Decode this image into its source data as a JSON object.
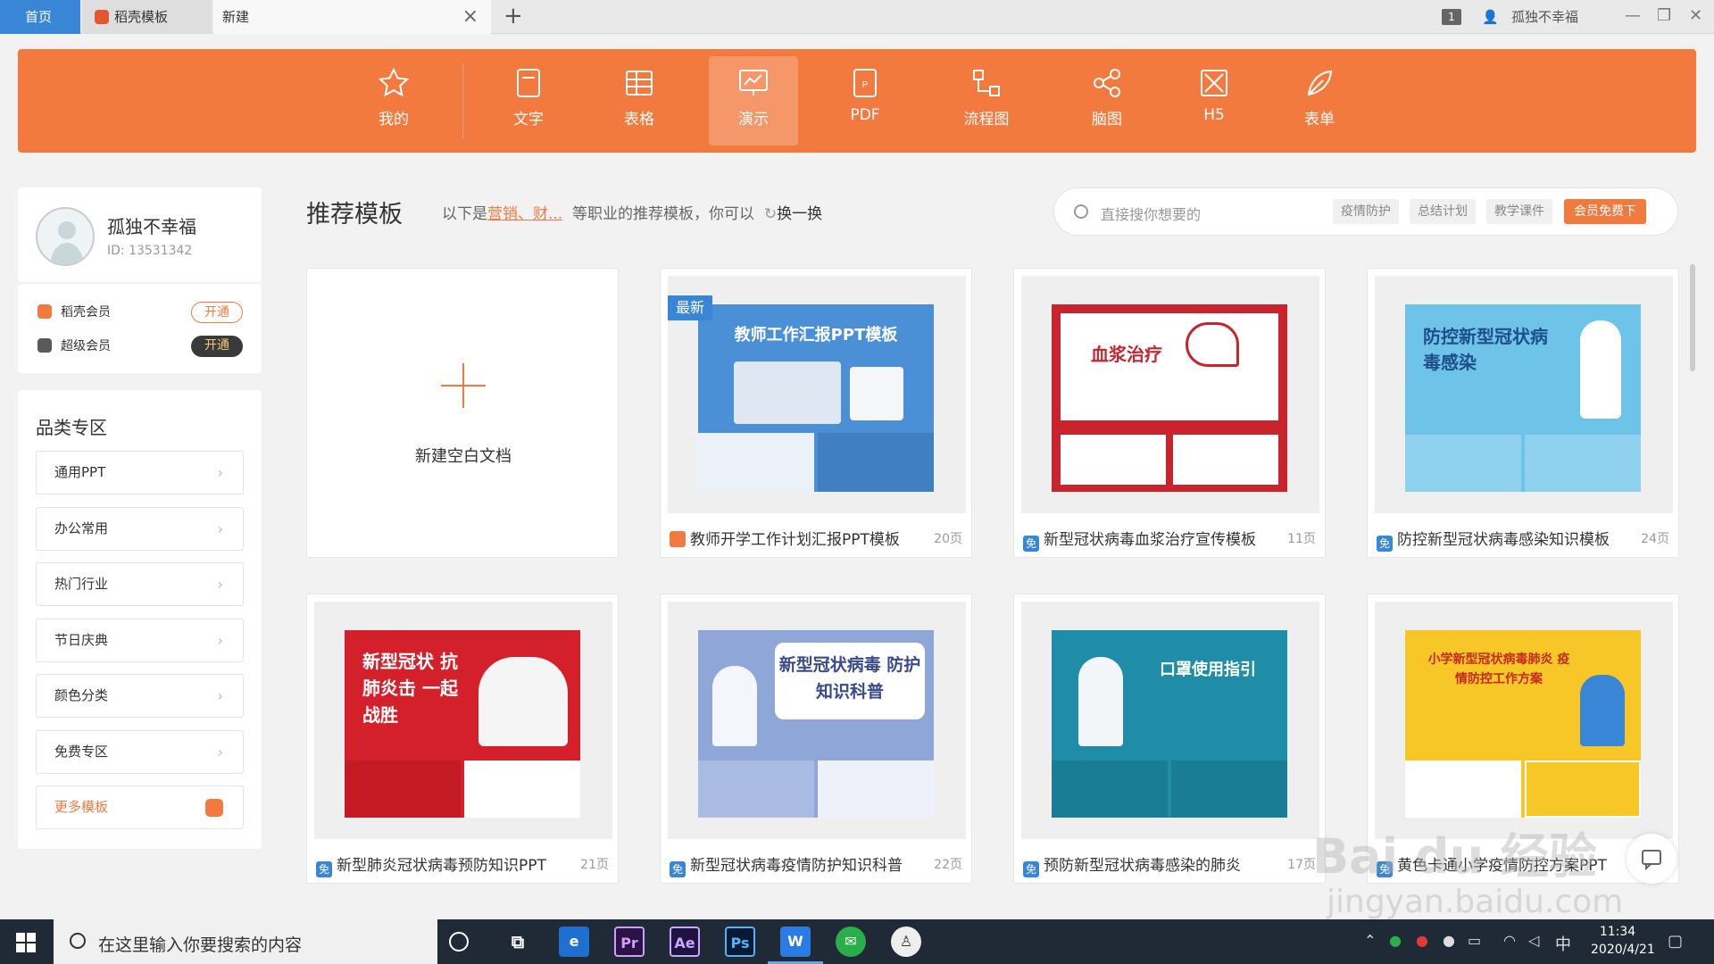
{
  "tabs": {
    "home": "首页",
    "template": "稻壳模板",
    "new": "新建",
    "new_tab": "+",
    "close": "×"
  },
  "titlebar": {
    "badge": "1",
    "username": "孤独不幸福",
    "minimize": "—",
    "restore": "❐",
    "close": "✕"
  },
  "nav": [
    {
      "label": "我的",
      "icon": "star-icon"
    },
    {
      "label": "文字",
      "icon": "document-icon"
    },
    {
      "label": "表格",
      "icon": "table-icon"
    },
    {
      "label": "演示",
      "icon": "presentation-icon"
    },
    {
      "label": "PDF",
      "icon": "pdf-icon"
    },
    {
      "label": "流程图",
      "icon": "flowchart-icon"
    },
    {
      "label": "脑图",
      "icon": "mindmap-icon"
    },
    {
      "label": "H5",
      "icon": "h5-icon"
    },
    {
      "label": "表单",
      "icon": "form-icon"
    }
  ],
  "user": {
    "name": "孤独不幸福",
    "id": "ID: 13531342"
  },
  "members": [
    {
      "label": "稻壳会员",
      "button": "开通"
    },
    {
      "label": "超级会员",
      "button": "开通"
    }
  ],
  "categories": {
    "title": "品类专区",
    "items": [
      "通用PPT",
      "办公常用",
      "热门行业",
      "节日庆典",
      "颜色分类",
      "免费专区"
    ],
    "more": "更多模板"
  },
  "recommend": {
    "title": "推荐模板",
    "sub_prefix": "以下是",
    "sub_highlight": "营销、财...",
    "sub_suffix": "等职业的推荐模板，你可以",
    "refresh": "换一换"
  },
  "search": {
    "placeholder": "直接搜你想要的",
    "tags": [
      "疫情防护",
      "总结计划",
      "教学课件"
    ],
    "vip": "会员免费下"
  },
  "blank_card": {
    "label": "新建空白文档"
  },
  "cards": [
    {
      "title": "教师开学工作计划汇报PPT模板",
      "pages": "20页",
      "badge": "最新",
      "thumb_title": "教师工作汇报PPT模板",
      "free": false
    },
    {
      "title": "新型冠状病毒血浆治疗宣传模板",
      "pages": "11页",
      "thumb_title": "血浆治疗",
      "free": true
    },
    {
      "title": "防控新型冠状病毒感染知识模板",
      "pages": "24页",
      "thumb_title": "防控新型冠状病毒感染",
      "free": true
    },
    {
      "title": "新型肺炎冠状病毒预防知识PPT",
      "pages": "21页",
      "thumb_title": "新型冠状 抗肺炎击 一起战胜",
      "free": true
    },
    {
      "title": "新型冠状病毒疫情防护知识科普",
      "pages": "22页",
      "thumb_title": "新型冠状病毒 防护知识科普",
      "free": true
    },
    {
      "title": "预防新型冠状病毒感染的肺炎",
      "pages": "17页",
      "thumb_title": "口罩使用指引",
      "free": true
    },
    {
      "title": "黄色卡通小学疫情防控方案PPT",
      "pages": "",
      "thumb_title": "小学新型冠状病毒肺炎 疫情防控工作方案",
      "free": true
    }
  ],
  "free_badge": "免",
  "taskbar": {
    "search_placeholder": "在这里输入你要搜索的内容",
    "time": "11:34",
    "date": "2020/4/21",
    "ime": "中"
  },
  "watermark": {
    "line1": "Bai du 经验",
    "line2": "jingyan.baidu.com"
  },
  "colors": {
    "accent": "#f37a3e",
    "blue": "#3a86d6",
    "taskbar": "#1f2a36"
  }
}
